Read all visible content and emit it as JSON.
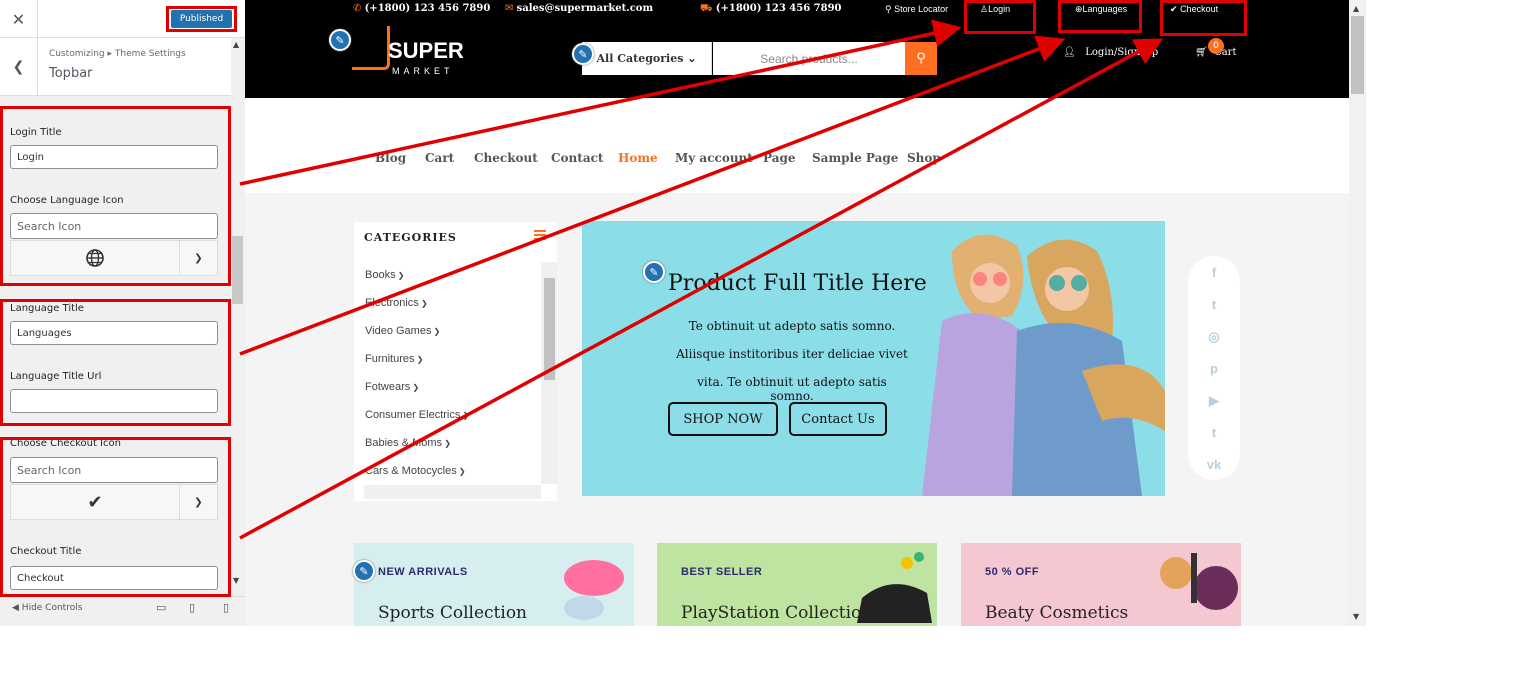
{
  "sidebar": {
    "close_icon": "close-icon",
    "publish_label": "Published",
    "breadcrumb": "Customizing ▸ Theme Settings",
    "section_title": "Topbar",
    "fields": {
      "login_title_label": "Login Title",
      "login_title_value": "Login",
      "lang_icon_label": "Choose Language Icon",
      "search_placeholder": "Search Icon",
      "language_title_label": "Language Title",
      "language_title_value": "Languages",
      "language_url_label": "Language Title Url",
      "language_url_value": "",
      "checkout_icon_label": "Choose Checkout Icon",
      "checkout_title_label": "Checkout Title",
      "checkout_title_value": "Checkout"
    },
    "footer": {
      "hide_controls": "Hide Controls"
    }
  },
  "preview": {
    "topbar": {
      "phone1": "(+1800) 123 456 7890",
      "email": "sales@supermarket.com",
      "phone2": "(+1800) 123 456 7890",
      "store_locator": "Store Locator",
      "login": "Login",
      "languages": "Languages",
      "checkout": "Checkout"
    },
    "header": {
      "logo_main": "SUPER",
      "logo_sub": "MARKET",
      "categories": "All Categories",
      "search_placeholder": "Search products...",
      "login_signup": "Login/Sign Up",
      "cart_label": "Cart",
      "cart_count": "0"
    },
    "nav": [
      "Blog",
      "Cart",
      "Checkout",
      "Contact",
      "Home",
      "My account",
      "Page",
      "Sample Page",
      "Shop"
    ],
    "nav_active": "Home",
    "categories": {
      "title": "CATEGORIES",
      "items": [
        "Books",
        "Electronics",
        "Video Games",
        "Furnitures",
        "Fotwears",
        "Consumer Electrics",
        "Babies & Moms",
        "Cars & Motocycles"
      ]
    },
    "banner": {
      "title": "Product Full Title Here",
      "lines": [
        "Te obtinuit ut adepto satis somno.",
        "Aliisque institoribus iter deliciae vivet",
        "vita. Te obtinuit ut adepto satis somno."
      ],
      "btn_shop": "SHOP NOW",
      "btn_contact": "Contact Us"
    },
    "social": [
      "f",
      "t",
      "◎",
      "p",
      "▶",
      "t",
      "vk"
    ],
    "promos": [
      {
        "tag": "NEW ARRIVALS",
        "title": "Sports Collection",
        "bg": "#d7eef0"
      },
      {
        "tag": "BEST SELLER",
        "title": "PlayStation Collection",
        "bg": "#bfe3a0"
      },
      {
        "tag": "50 % OFF",
        "title": "Beaty Cosmetics",
        "bg": "#f4c7d1"
      }
    ]
  },
  "colors": {
    "accent": "#ff6f21",
    "annotation": "#e00000",
    "wp_blue": "#2271b1"
  }
}
